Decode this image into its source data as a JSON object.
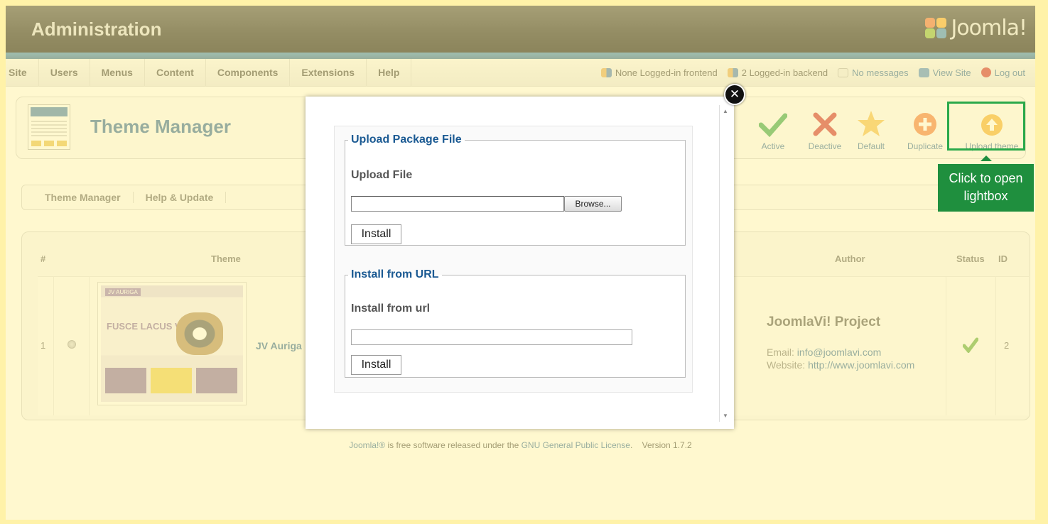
{
  "header": {
    "title": "Administration",
    "logo_text": "Joomla!"
  },
  "menu": [
    "Site",
    "Users",
    "Menus",
    "Content",
    "Components",
    "Extensions",
    "Help"
  ],
  "status": {
    "frontend": "None Logged-in frontend",
    "backend": "2 Logged-in backend",
    "messages": "No messages",
    "view_site": "View Site",
    "logout": "Log out"
  },
  "toolbar": {
    "title": "Theme Manager",
    "buttons": [
      "Active",
      "Deactive",
      "Default",
      "Duplicate",
      "Upload theme"
    ]
  },
  "callout": {
    "line1": "Click to open",
    "line2": "lightbox"
  },
  "tabs": [
    "Theme Manager",
    "Help & Update"
  ],
  "table": {
    "headers": {
      "num": "#",
      "theme": "Theme",
      "author": "Author",
      "status": "Status",
      "id": "ID"
    },
    "rows": [
      {
        "num": "1",
        "theme_name": "JV Auriga",
        "thumb_headline": "FUSCE LACUS VELIT",
        "thumb_logo": "JV AURIGA",
        "author_name": "JoomlaVi! Project",
        "email_label": "Email:",
        "email": "info@joomlavi.com",
        "website_label": "Website:",
        "website": "http://www.joomlavi.com",
        "id": "2"
      }
    ]
  },
  "footer": {
    "prefix": "Joomla!®",
    "middle": " is free software released under the ",
    "license": "GNU General Public License",
    "version": "Version 1.7.2"
  },
  "modal": {
    "close_symbol": "✕",
    "upload": {
      "legend": "Upload Package File",
      "label": "Upload File",
      "browse": "Browse...",
      "install": "Install",
      "file_value": ""
    },
    "url": {
      "legend": "Install from URL",
      "label": "Install from url",
      "install": "Install",
      "url_value": ""
    }
  },
  "colors": {
    "accent": "#1b5a93",
    "callout": "#1f8f3e",
    "background": "#fff2a8"
  }
}
